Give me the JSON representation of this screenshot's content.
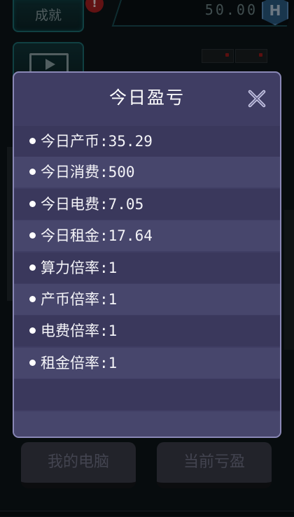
{
  "background": {
    "achievement_label": "成就",
    "achievement_badge": "!",
    "coin_value": "50.00",
    "coin_icon_letter": "H",
    "bottom_left_label": "我的电脑",
    "bottom_right_label": "当前亏盈"
  },
  "dialog": {
    "title": "今日盈亏",
    "close_icon": "close-x-icon",
    "rows": [
      "今日产币:35.29",
      "今日消费:500",
      "今日电费:7.05",
      "今日租金:17.64",
      "算力倍率:1",
      "产币倍率:1",
      "电费倍率:1",
      "租金倍率:1",
      "",
      ""
    ]
  },
  "colors": {
    "dialog_bg": "#3f3d63",
    "dialog_border": "#8a88b6",
    "row_dark": "#3a385c",
    "row_light": "#47466c",
    "accent_teal": "#1d6f73",
    "badge_red": "#a81f22"
  }
}
